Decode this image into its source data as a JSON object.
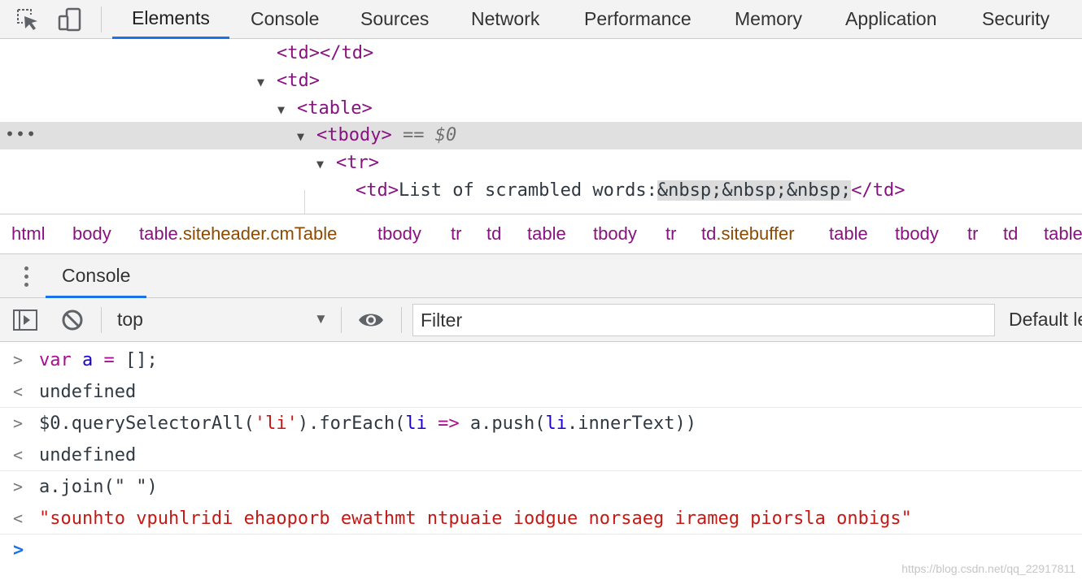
{
  "tabs": [
    "Elements",
    "Console",
    "Sources",
    "Network",
    "Performance",
    "Memory",
    "Application",
    "Security"
  ],
  "active_tab": "Elements",
  "dom_tree": {
    "line1": {
      "open": "<td>",
      "close": "</td>"
    },
    "line2": {
      "triangle": "▼",
      "tag": "<td>"
    },
    "line3": {
      "triangle": "▼",
      "tag": "<table>"
    },
    "line4": {
      "ellipsis": "•••",
      "triangle": "▼",
      "tag": "<tbody>",
      "eq": "==",
      "ref": "$0"
    },
    "line5": {
      "triangle": "▼",
      "tag": "<tr>"
    },
    "line6": {
      "open": "<td>",
      "text": "List of scrambled words:",
      "nbsp": "&nbsp;&nbsp;&nbsp;",
      "close": "</td>"
    }
  },
  "breadcrumbs": [
    {
      "tag": "html",
      "cls": ""
    },
    {
      "tag": "body",
      "cls": ""
    },
    {
      "tag": "table",
      "cls": ".siteheader.cmTable"
    },
    {
      "tag": "tbody",
      "cls": ""
    },
    {
      "tag": "tr",
      "cls": ""
    },
    {
      "tag": "td",
      "cls": ""
    },
    {
      "tag": "table",
      "cls": ""
    },
    {
      "tag": "tbody",
      "cls": ""
    },
    {
      "tag": "tr",
      "cls": ""
    },
    {
      "tag": "td",
      "cls": ".sitebuffer"
    },
    {
      "tag": "table",
      "cls": ""
    },
    {
      "tag": "tbody",
      "cls": ""
    },
    {
      "tag": "tr",
      "cls": ""
    },
    {
      "tag": "td",
      "cls": ""
    },
    {
      "tag": "table",
      "cls": ""
    }
  ],
  "drawer": {
    "tab": "Console"
  },
  "console_toolbar": {
    "context": "top",
    "filter_placeholder": "Filter",
    "levels": "Default le"
  },
  "console_messages": {
    "m1": {
      "kw": "var",
      "sp": " ",
      "v": "a",
      "eq": " = ",
      "rest": "[];"
    },
    "r1": "undefined",
    "m2": {
      "a": "$0.querySelectorAll(",
      "s": "'li'",
      "b": ").forEach(",
      "v1": "li",
      "arr": " => ",
      "c": "a.push(",
      "v2": "li",
      "d": ".innerText))"
    },
    "r2": "undefined",
    "m3": "a.join(\" \")",
    "r3": "\"sounhto vpuhlridi ehaoporb ewathmt ntpuaie iodgue norsaeg irameg piorsla onbigs\""
  },
  "watermark": "https://blog.csdn.net/qq_22917811",
  "icons": [
    "inspect-element-icon",
    "device-toolbar-icon",
    "show-sidebar-icon",
    "clear-console-icon",
    "eye-icon",
    "dropdown-arrow-icon",
    "kebab-menu-icon"
  ],
  "colors": {
    "accent": "#1a73e8",
    "tag": "#881280",
    "string": "#c41a16",
    "keyword": "#aa0d91"
  }
}
